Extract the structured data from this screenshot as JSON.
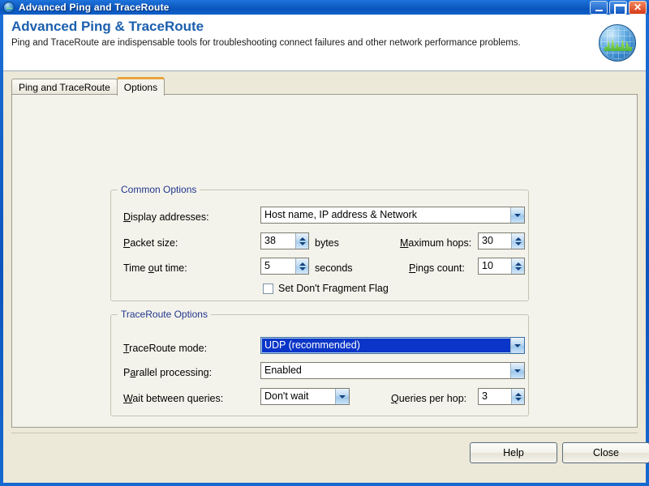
{
  "window": {
    "title": "Advanced Ping and TraceRoute",
    "icon": "app-globe-pulse-icon",
    "controls": {
      "minimize": "minimize-icon",
      "maximize": "maximize-icon",
      "close": "✕"
    }
  },
  "header": {
    "title": "Advanced Ping & TraceRoute",
    "description": "Ping and TraceRoute are indispensable tools for troubleshooting connect failures and other network performance problems.",
    "logo": "globe-pulse-logo-icon"
  },
  "tabs": [
    {
      "label": "Ping and TraceRoute",
      "active": false
    },
    {
      "label": "Options",
      "active": true
    }
  ],
  "common_options": {
    "legend": "Common Options",
    "display_addresses": {
      "label_pre": "",
      "accel": "D",
      "label_post": "isplay addresses:",
      "value": "Host name, IP address & Network"
    },
    "packet_size": {
      "label_pre": "",
      "accel": "P",
      "label_post": "acket size:",
      "value": "38",
      "unit": "bytes"
    },
    "maximum_hops": {
      "label_pre": "",
      "accel": "M",
      "label_post": "aximum hops:",
      "value": "30"
    },
    "time_out_time": {
      "label_pre": "Time ",
      "accel": "o",
      "label_post": "ut time:",
      "value": "5",
      "unit": "seconds"
    },
    "pings_count": {
      "label_pre": "",
      "accel": "P",
      "label_post": "ings count:",
      "value": "10"
    },
    "dont_fragment": {
      "label": "Set Don't Fragment Flag",
      "checked": false
    }
  },
  "traceroute_options": {
    "legend": "TraceRoute Options",
    "traceroute_mode": {
      "label_pre": "",
      "accel": "T",
      "label_post": "raceRoute mode:",
      "value": "UDP (recommended)",
      "focused": true
    },
    "parallel_processing": {
      "label_pre": "P",
      "accel": "a",
      "label_post": "rallel processing:",
      "value": "Enabled"
    },
    "wait_between_queries": {
      "label_pre": "",
      "accel": "W",
      "label_post": "ait between queries:",
      "value": "Don't wait"
    },
    "queries_per_hop": {
      "label_pre": "",
      "accel": "Q",
      "label_post": "ueries per hop:",
      "value": "3"
    }
  },
  "buttons": {
    "help": "Help",
    "close": "Close"
  },
  "colors": {
    "title_blue": "#1B5FAE",
    "legend_blue": "#20368C",
    "selection_blue": "#0A35C8",
    "tab_accent": "#E8A33D",
    "panel_bg": "#F4F3EB",
    "client_bg": "#ECE9D8"
  }
}
